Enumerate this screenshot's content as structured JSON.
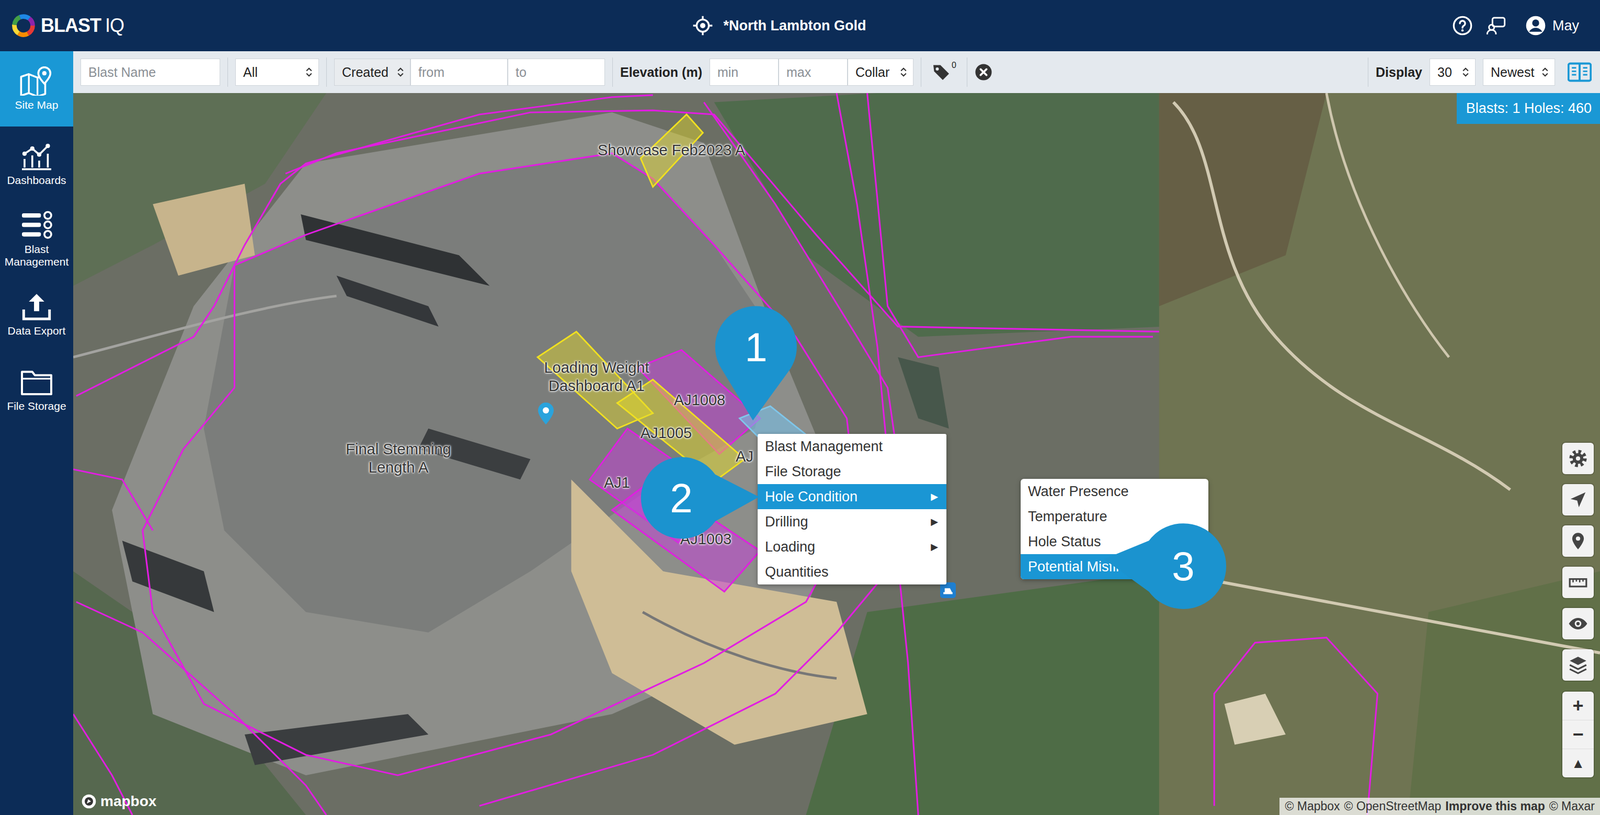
{
  "topbar": {
    "logo": {
      "primary": "BLAST",
      "secondary": "IQ"
    },
    "site": "*North Lambton Gold",
    "user": "May"
  },
  "sidebar": {
    "items": [
      {
        "label": "Site Map",
        "selected": true
      },
      {
        "label": "Dashboards",
        "selected": false
      },
      {
        "label": "Blast Management",
        "selected": false
      },
      {
        "label": "Data Export",
        "selected": false
      },
      {
        "label": "File Storage",
        "selected": false
      }
    ]
  },
  "filters": {
    "blast_name": {
      "placeholder": "Blast Name"
    },
    "type": {
      "value": "All"
    },
    "date": {
      "field": "Created",
      "from_placeholder": "from",
      "to_placeholder": "to"
    },
    "elevation": {
      "label": "Elevation (m)",
      "min_placeholder": "min",
      "max_placeholder": "max",
      "reference": "Collar"
    },
    "tags": {
      "count": "0"
    },
    "display": {
      "label": "Display",
      "count": "30",
      "order": "Newest"
    }
  },
  "map": {
    "summary": "Blasts: 1 Holes: 460",
    "labels": [
      "Showcase Feb2023 A",
      "Loading Weight Dashboard A1",
      "Final Stemming Length A",
      "AJ1008",
      "AJ1005",
      "AJ1",
      "AJ1003",
      "AJ"
    ],
    "controls": [
      "+",
      "−",
      "▲"
    ],
    "logo": "mapbox",
    "attribution": [
      {
        "text": "© Mapbox",
        "bold": false
      },
      {
        "text": "© OpenStreetMap",
        "bold": false
      },
      {
        "text": "Improve this map",
        "bold": true
      },
      {
        "text": "© Maxar",
        "bold": false
      }
    ]
  },
  "context_menu": {
    "submenu_arrow": "▶",
    "items": [
      {
        "label": "Blast Management",
        "submenu": false,
        "selected": false
      },
      {
        "label": "File Storage",
        "submenu": false,
        "selected": false
      },
      {
        "label": "Hole Condition",
        "submenu": true,
        "selected": true
      },
      {
        "label": "Drilling",
        "submenu": true,
        "selected": false
      },
      {
        "label": "Loading",
        "submenu": true,
        "selected": false
      },
      {
        "label": "Quantities",
        "submenu": false,
        "selected": false
      }
    ]
  },
  "submenu": {
    "items": [
      {
        "label": "Water Presence",
        "selected": false
      },
      {
        "label": "Temperature",
        "selected": false
      },
      {
        "label": "Hole Status",
        "selected": false
      },
      {
        "label": "Potential Misfire",
        "selected": true
      }
    ]
  },
  "callouts": [
    "1",
    "2",
    "3"
  ]
}
